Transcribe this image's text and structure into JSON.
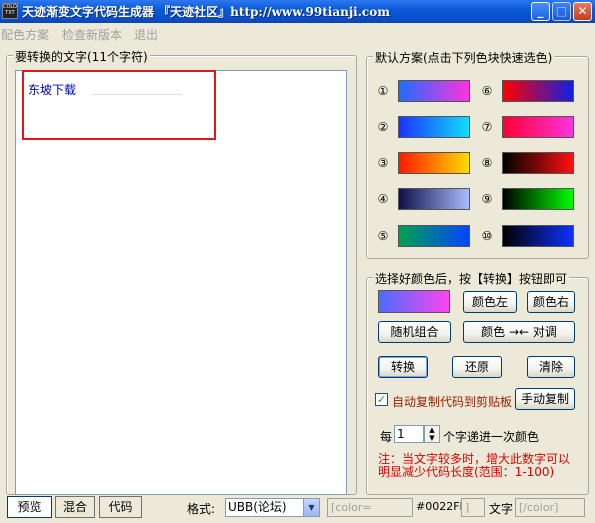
{
  "window": {
    "title": "天迹渐变文字代码生成器  『天迹社区』http://www.99tianji.com",
    "icon_text": "COLOR TXT"
  },
  "menu": [
    "配色方案",
    "检查新版本",
    "退出"
  ],
  "left_group": {
    "title": "要转换的文字(11个字符)",
    "text": "东坡下载"
  },
  "presets": {
    "title": "默认方案(点击下列色块快速选色)",
    "items": [
      {
        "num": "①",
        "colors": [
          "#1f6cff",
          "#ff33dd"
        ]
      },
      {
        "num": "②",
        "colors": [
          "#1a33ff",
          "#11ddff"
        ]
      },
      {
        "num": "③",
        "colors": [
          "#ff1a00",
          "#ffdd00"
        ]
      },
      {
        "num": "④",
        "colors": [
          "#10104a",
          "#aabbff"
        ]
      },
      {
        "num": "⑤",
        "colors": [
          "#00a050",
          "#0044ff"
        ]
      },
      {
        "num": "⑥",
        "colors": [
          "#ff0000",
          "#1020e0"
        ]
      },
      {
        "num": "⑦",
        "colors": [
          "#ff0033",
          "#ff33dd"
        ]
      },
      {
        "num": "⑧",
        "colors": [
          "#000000",
          "#ff1010"
        ]
      },
      {
        "num": "⑨",
        "colors": [
          "#000000",
          "#00ff00"
        ]
      },
      {
        "num": "⑩",
        "colors": [
          "#000000",
          "#1030ff"
        ]
      }
    ]
  },
  "controls": {
    "title": "选择好颜色后，按【转换】按钮即可",
    "preview_colors": [
      "#4b6cff",
      "#ff44ee"
    ],
    "color_left": "颜色左",
    "color_right": "颜色右",
    "random": "随机组合",
    "swap": "颜色 →← 对调",
    "convert": "转换",
    "restore": "还原",
    "clear": "清除",
    "auto_copy": "自动复制代码到剪贴板",
    "auto_copy_checked": true,
    "manual_copy": "手动复制",
    "every_prefix": "每",
    "every_value": "1",
    "every_suffix": "个字递进一次颜色",
    "note_line1": "注：当文字较多时，增大此数字可以",
    "note_line2": "明显减少代码长度(范围：1-100)"
  },
  "bottom": {
    "tabs": [
      "预览",
      "混合",
      "代码"
    ],
    "active_tab": "预览",
    "format_label": "格式:",
    "format_value": "UBB(论坛)",
    "color_open": "[color=",
    "color_value": "#0022FF",
    "close_bracket": "]",
    "text_label": "文字",
    "color_close": "[/color]"
  }
}
